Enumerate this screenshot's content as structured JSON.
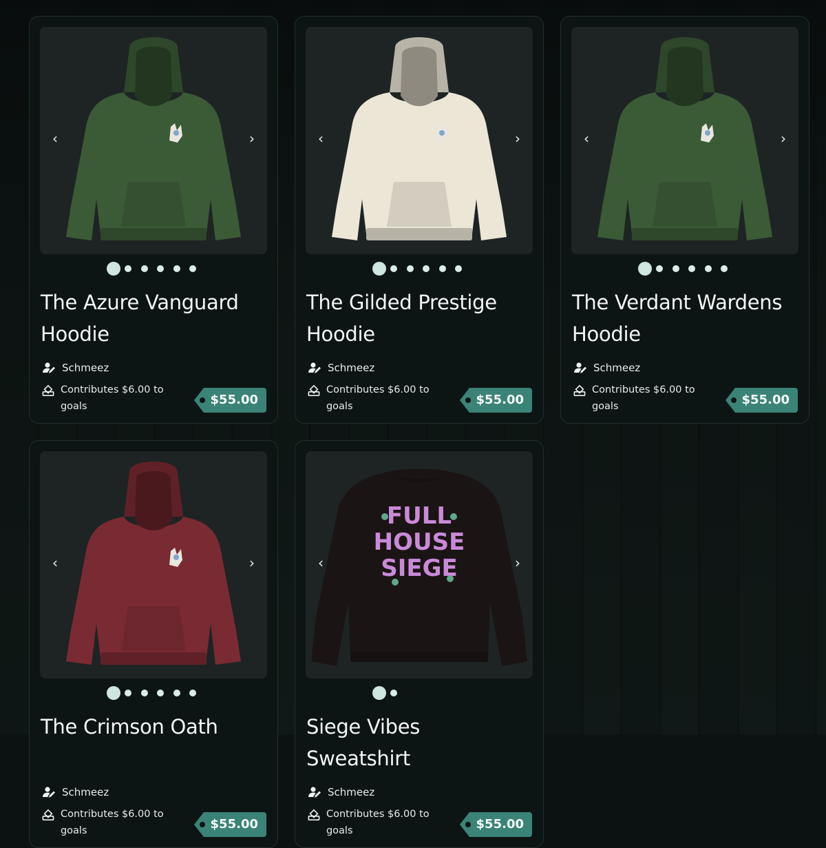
{
  "colors": {
    "accent": "#3b8377",
    "card_bg": "#0d1414",
    "image_bg": "#1e2424",
    "dot": "#d9ece8"
  },
  "icons": {
    "prev": "chevron-left-icon",
    "next": "chevron-right-icon",
    "creator": "user-edit-icon",
    "contribution": "donation-icon"
  },
  "products": [
    {
      "title": "The Azure Vanguard Hoodie",
      "creator": "Schmeez",
      "contribution": "Contributes $6.00 to goals",
      "price": "$55.00",
      "garment": "hoodie",
      "garment_color": "#3b5a36",
      "image_count": 6,
      "active_image": 0
    },
    {
      "title": "The Gilded Prestige Hoodie",
      "creator": "Schmeez",
      "contribution": "Contributes $6.00 to goals",
      "price": "$55.00",
      "garment": "hoodie",
      "garment_color": "#ece6d6",
      "image_count": 6,
      "active_image": 0
    },
    {
      "title": "The Verdant Wardens Hoodie",
      "creator": "Schmeez",
      "contribution": "Contributes $6.00 to goals",
      "price": "$55.00",
      "garment": "hoodie",
      "garment_color": "#3b5a36",
      "image_count": 6,
      "active_image": 0
    },
    {
      "title": "The Crimson Oath",
      "creator": "Schmeez",
      "contribution": "Contributes $6.00 to goals",
      "price": "$55.00",
      "garment": "hoodie",
      "garment_color": "#7a2a32",
      "image_count": 6,
      "active_image": 0
    },
    {
      "title": "Siege Vibes Sweatshirt",
      "creator": "Schmeez",
      "contribution": "Contributes $6.00 to goals",
      "price": "$55.00",
      "garment": "sweatshirt",
      "garment_color": "#1b1414",
      "print_text": "FULL HOUSE SIEGE",
      "image_count": 2,
      "active_image": 0
    }
  ]
}
